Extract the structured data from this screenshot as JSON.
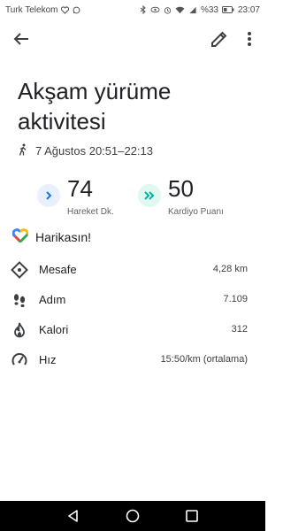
{
  "status_bar": {
    "carrier": "Turk Telekom",
    "battery": "%33",
    "time": "23:07"
  },
  "app_bar": {
    "back_icon": "arrow-back-icon",
    "edit_icon": "pencil-icon",
    "more_icon": "more-vert-icon"
  },
  "activity": {
    "title": "Akşam yürüme aktivitesi",
    "date_range": "7 Ağustos 20:51–22:13"
  },
  "metrics": {
    "move_minutes": {
      "value": "74",
      "label": "Hareket Dk.",
      "color": "#1a73e8"
    },
    "heart_points": {
      "value": "50",
      "label": "Kardiyo Puanı",
      "color": "#00b39f"
    }
  },
  "praise": {
    "text": "Harikasın!"
  },
  "stats": [
    {
      "name": "Mesafe",
      "value": "4,28 km",
      "icon": "distance-icon"
    },
    {
      "name": "Adım",
      "value": "7.109",
      "icon": "footsteps-icon"
    },
    {
      "name": "Kalori",
      "value": "312",
      "icon": "flame-icon"
    },
    {
      "name": "Hız",
      "value": "15:50/km (ortalama)",
      "icon": "speedometer-icon"
    }
  ],
  "nav_bar": {
    "back": "nav-back-icon",
    "home": "nav-home-icon",
    "recents": "nav-recents-icon"
  }
}
